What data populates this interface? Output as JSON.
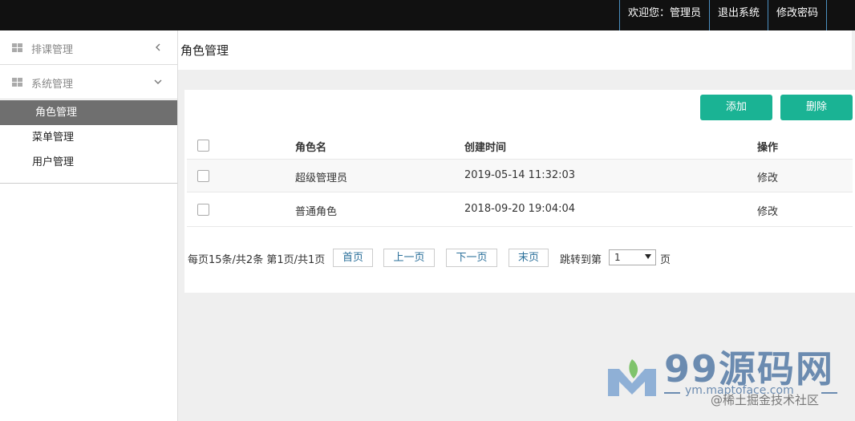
{
  "topbar": {
    "welcome": "欢迎您：管理员",
    "logout": "退出系统",
    "change_password": "修改密码"
  },
  "sidebar": {
    "groups": [
      {
        "label": "排课管理",
        "icon": "grid-icon",
        "state": "collapsed"
      },
      {
        "label": "系统管理",
        "icon": "grid-icon",
        "state": "expanded"
      }
    ],
    "items": [
      {
        "label": "角色管理",
        "active": true
      },
      {
        "label": "菜单管理",
        "active": false
      },
      {
        "label": "用户管理",
        "active": false
      }
    ]
  },
  "header": {
    "title": "角色管理"
  },
  "toolbar": {
    "add_label": "添加",
    "delete_label": "删除",
    "accent": "#1ab394"
  },
  "table": {
    "columns": [
      "角色名",
      "创建时间",
      "操作"
    ],
    "rows": [
      {
        "name": "超级管理员",
        "created": "2019-05-14 11:32:03",
        "action": "修改"
      },
      {
        "name": "普通角色",
        "created": "2018-09-20 19:04:04",
        "action": "修改"
      }
    ]
  },
  "pagination": {
    "info": "每页15条/共2条 第1页/共1页",
    "first": "首页",
    "prev": "上一页",
    "next": "下一页",
    "last": "末页",
    "jump_label": "跳转到第",
    "jump_value": "1",
    "page_unit": "页"
  },
  "watermark": {
    "brand": "99源码网",
    "url": "ym.maptoface.com",
    "community": "@稀土掘金技术社区"
  }
}
